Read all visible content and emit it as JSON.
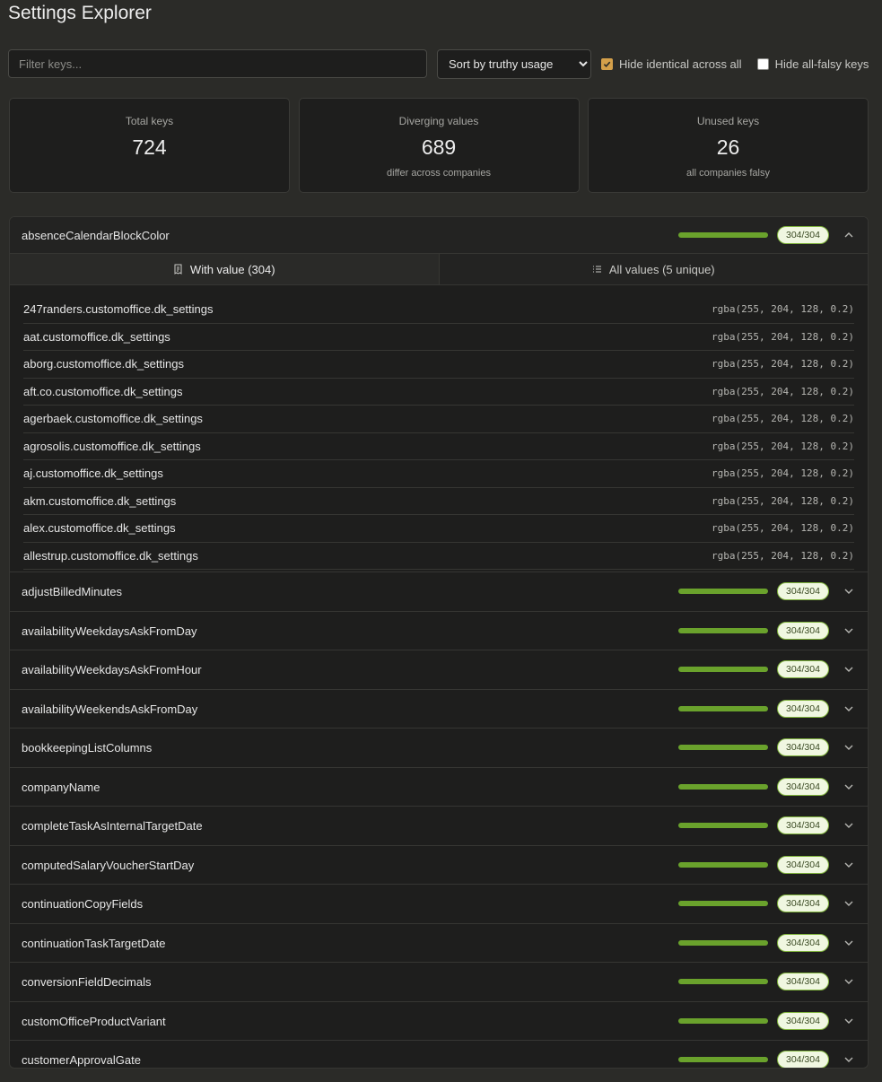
{
  "app": {
    "title": "Settings Explorer"
  },
  "toolbar": {
    "filter_placeholder": "Filter keys...",
    "sort_options": [
      "Sort by truthy usage"
    ],
    "hide_identical_label": "Hide identical across all",
    "hide_identical_checked": true,
    "hide_falsy_label": "Hide all-falsy keys",
    "hide_falsy_checked": false
  },
  "stats": [
    {
      "label": "Total keys",
      "value": "724",
      "sub": ""
    },
    {
      "label": "Diverging values",
      "value": "689",
      "sub": "differ across companies"
    },
    {
      "label": "Unused keys",
      "value": "26",
      "sub": "all companies falsy"
    }
  ],
  "expanded": {
    "name": "absenceCalendarBlockColor",
    "badge": "304/304",
    "usage_fraction": 1.0,
    "tab_with_value": "With value (304)",
    "tab_all_values": "All values (5 unique)",
    "rows": [
      {
        "company": "247randers.customoffice.dk_settings",
        "value": "rgba(255, 204, 128, 0.2)"
      },
      {
        "company": "aat.customoffice.dk_settings",
        "value": "rgba(255, 204, 128, 0.2)"
      },
      {
        "company": "aborg.customoffice.dk_settings",
        "value": "rgba(255, 204, 128, 0.2)"
      },
      {
        "company": "aft.co.customoffice.dk_settings",
        "value": "rgba(255, 204, 128, 0.2)"
      },
      {
        "company": "agerbaek.customoffice.dk_settings",
        "value": "rgba(255, 204, 128, 0.2)"
      },
      {
        "company": "agrosolis.customoffice.dk_settings",
        "value": "rgba(255, 204, 128, 0.2)"
      },
      {
        "company": "aj.customoffice.dk_settings",
        "value": "rgba(255, 204, 128, 0.2)"
      },
      {
        "company": "akm.customoffice.dk_settings",
        "value": "rgba(255, 204, 128, 0.2)"
      },
      {
        "company": "alex.customoffice.dk_settings",
        "value": "rgba(255, 204, 128, 0.2)"
      },
      {
        "company": "allestrup.customoffice.dk_settings",
        "value": "rgba(255, 204, 128, 0.2)"
      }
    ]
  },
  "keys": [
    {
      "name": "adjustBilledMinutes",
      "badge": "304/304",
      "usage_fraction": 1.0
    },
    {
      "name": "availabilityWeekdaysAskFromDay",
      "badge": "304/304",
      "usage_fraction": 1.0
    },
    {
      "name": "availabilityWeekdaysAskFromHour",
      "badge": "304/304",
      "usage_fraction": 1.0
    },
    {
      "name": "availabilityWeekendsAskFromDay",
      "badge": "304/304",
      "usage_fraction": 1.0
    },
    {
      "name": "bookkeepingListColumns",
      "badge": "304/304",
      "usage_fraction": 1.0
    },
    {
      "name": "companyName",
      "badge": "304/304",
      "usage_fraction": 1.0
    },
    {
      "name": "completeTaskAsInternalTargetDate",
      "badge": "304/304",
      "usage_fraction": 1.0
    },
    {
      "name": "computedSalaryVoucherStartDay",
      "badge": "304/304",
      "usage_fraction": 1.0
    },
    {
      "name": "continuationCopyFields",
      "badge": "304/304",
      "usage_fraction": 1.0
    },
    {
      "name": "continuationTaskTargetDate",
      "badge": "304/304",
      "usage_fraction": 1.0
    },
    {
      "name": "conversionFieldDecimals",
      "badge": "304/304",
      "usage_fraction": 1.0
    },
    {
      "name": "customOfficeProductVariant",
      "badge": "304/304",
      "usage_fraction": 1.0
    },
    {
      "name": "customerApprovalGate",
      "badge": "304/304",
      "usage_fraction": 1.0
    }
  ],
  "colors": {
    "accent": "#d4a04a",
    "bar": "#6aa22c",
    "badge_bg": "#f0f7e1",
    "badge_border": "#7fb33c"
  },
  "icons": {
    "with_value_tab": "receipt-icon",
    "all_values_tab": "list-icon",
    "expand": "chevron-down-icon",
    "collapse": "chevron-up-icon"
  }
}
